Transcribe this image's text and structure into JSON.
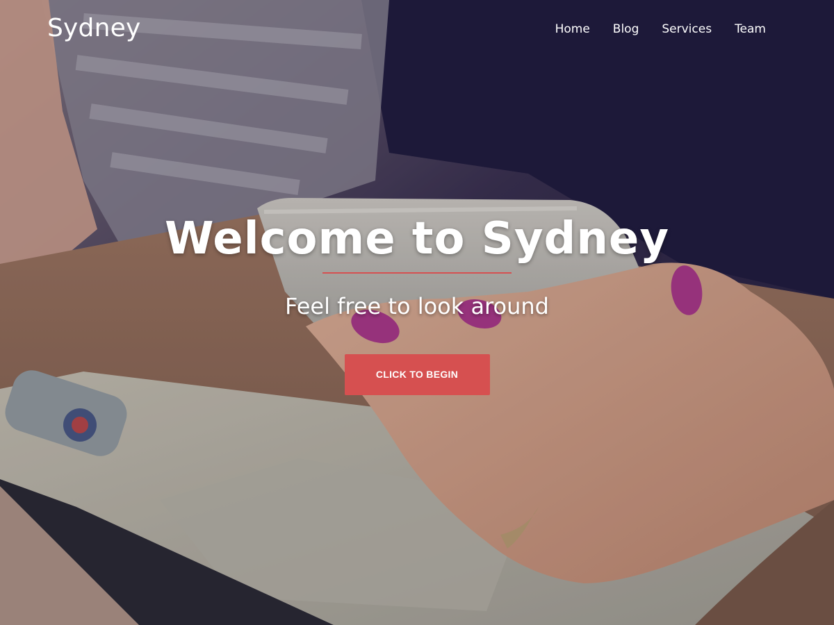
{
  "header": {
    "site_title": "Sydney",
    "nav": [
      {
        "label": "Home"
      },
      {
        "label": "Blog"
      },
      {
        "label": "Services"
      },
      {
        "label": "Team"
      }
    ]
  },
  "hero": {
    "title": "Welcome to Sydney",
    "subtitle": "Feel free to look around",
    "button_label": "CLICK TO BEGIN"
  },
  "colors": {
    "accent": "#d65050",
    "text": "#ffffff"
  }
}
